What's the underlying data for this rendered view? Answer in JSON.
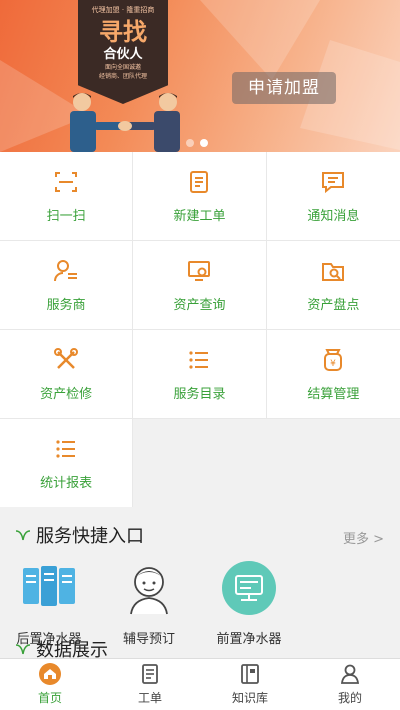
{
  "banner": {
    "badge_top": "代理加盟 · 隆重招商",
    "badge_title": "寻找",
    "badge_subtitle": "合伙人",
    "badge_line1": "面向全国诚邀",
    "badge_line2": "经销商、团队代理",
    "apply_label": "申请加盟",
    "slide_count": 2,
    "active_slide": 2
  },
  "menu": [
    {
      "label": "扫一扫",
      "icon": "scan-icon"
    },
    {
      "label": "新建工单",
      "icon": "new-order-icon"
    },
    {
      "label": "通知消息",
      "icon": "message-icon"
    },
    {
      "label": "服务商",
      "icon": "provider-icon"
    },
    {
      "label": "资产查询",
      "icon": "asset-query-icon"
    },
    {
      "label": "资产盘点",
      "icon": "asset-inventory-icon"
    },
    {
      "label": "资产检修",
      "icon": "repair-icon"
    },
    {
      "label": "服务目录",
      "icon": "list-icon"
    },
    {
      "label": "结算管理",
      "icon": "settlement-icon"
    },
    {
      "label": "统计报表",
      "icon": "report-icon"
    }
  ],
  "quick": {
    "title": "服务快捷入口",
    "more_label": "更多 >",
    "items": [
      {
        "label": "后置净水器",
        "icon": "filter-icon"
      },
      {
        "label": "辅导预订",
        "icon": "person-icon"
      },
      {
        "label": "前置净水器",
        "icon": "device-icon"
      }
    ]
  },
  "data_section": {
    "title": "数据展示"
  },
  "tabbar": [
    {
      "label": "首页",
      "icon": "home-icon",
      "active": true
    },
    {
      "label": "工单",
      "icon": "order-icon",
      "active": false
    },
    {
      "label": "知识库",
      "icon": "book-icon",
      "active": false
    },
    {
      "label": "我的",
      "icon": "user-icon",
      "active": false
    }
  ],
  "colors": {
    "accent": "#3aa13a",
    "icon_orange": "#e8892b",
    "banner": "#ef6a3a"
  }
}
